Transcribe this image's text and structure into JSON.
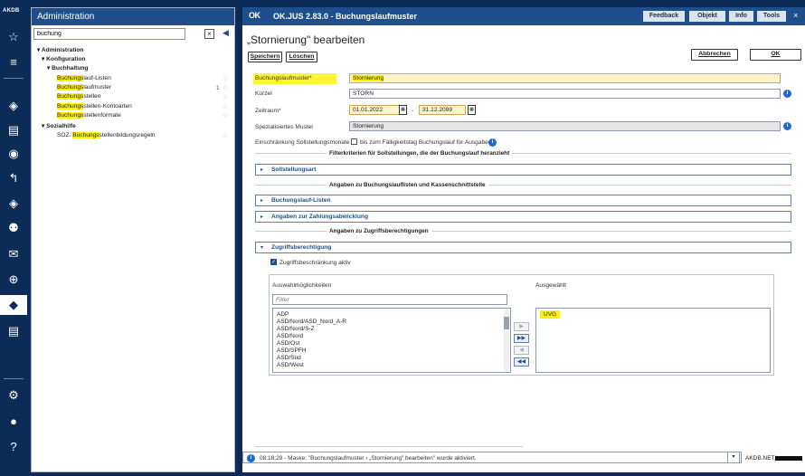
{
  "rail": {
    "logo": "AKDB",
    "icons": [
      "star-icon",
      "menu-icon",
      "user-gear-icon",
      "document-settings-icon",
      "people-search-icon",
      "flow-icon",
      "family-gear-icon",
      "family-icon",
      "mail-icon",
      "target-icon",
      "user-admin-icon",
      "document-gear-icon",
      "settings-gears-icon",
      "user-icon",
      "help-icon"
    ],
    "glyphs": {
      "star": "☆",
      "menu": "≡",
      "mail": "✉",
      "target": "⊕",
      "user": "●",
      "help": "?",
      "gears": "⚙",
      "doc": "▤",
      "generic": "◈"
    }
  },
  "admin": {
    "title": "Administration",
    "search_value": "buchung",
    "tree": [
      {
        "label": "Administration",
        "level": 0,
        "bold": true,
        "caret": "▾"
      },
      {
        "label": "Konfiguration",
        "level": 1,
        "bold": true,
        "caret": "▾"
      },
      {
        "label": "Buchhaltung",
        "level": 2,
        "bold": true,
        "caret": "▾"
      },
      {
        "hl": "Buchungs",
        "rest": "lauf-Listen",
        "level": 3,
        "star": true
      },
      {
        "hl": "Buchungs",
        "rest": "laufmuster",
        "level": 3,
        "star": true,
        "count": "1"
      },
      {
        "hl": "Buchungs",
        "rest": "stellen",
        "level": 3,
        "star": true
      },
      {
        "hl": "Buchungs",
        "rest": "stellen-Kontoarten",
        "level": 3,
        "star": true
      },
      {
        "hl": "Buchungs",
        "rest": "stellenformate",
        "level": 3,
        "star": true
      },
      {
        "label": "Sozialhilfe",
        "level": 1,
        "bold": true,
        "caret": "▾"
      },
      {
        "pre": "SOZ. ",
        "hl": "Buchungs",
        "rest": "stellenbildungsregeln",
        "level": 3,
        "star": true
      }
    ]
  },
  "window": {
    "app_logo": "OK",
    "title": "OK.JUS 2.83.0 - Buchungslaufmuster",
    "top_buttons": [
      "Feedback",
      "Objekt",
      "Info",
      "Tools"
    ],
    "close": "×"
  },
  "form": {
    "heading": "„Stornierung\" bearbeiten",
    "buttons": {
      "save": "Speichern",
      "delete": "Löschen",
      "cancel": "Abbrechen",
      "ok": "OK"
    },
    "fields": {
      "muster_label": "Buchungslaufmuster*",
      "muster_value": "Stornierung",
      "kuerzel_label": "Kürzel",
      "kuerzel_value": "STORN",
      "zeitraum_label": "Zeitraum*",
      "date_from": "01.01.2022",
      "date_sep": "-",
      "date_to": "31.12.2099",
      "spez_label": "Spezialisiertes Muster",
      "spez_value": "Stornierung",
      "einschr_label": "Einschränkung Sollstellungsmonate",
      "einschr_option": "bis zum Fälligkeitstag Buchungslauf für Ausgaben"
    },
    "sections": {
      "filter_title": "Filterkriterien für Sollstellungen, die der Buchungslauf heranzieht",
      "sollstellungsart": "Sollstellungsart",
      "angaben_listen_title": "Angaben zu Buchungslauflisten und Kassenschnittstelle",
      "buchungslauf_listen": "Buchungslauf-Listen",
      "zahlungsabwicklung": "Angaben zur Zahlungsabwicklung",
      "zugriff_title": "Angaben zu Zugriffsberechtigungen",
      "zugriffsberechtigung": "Zugriffsberechtigung"
    },
    "zugriff": {
      "checkbox_label": "Zugriffsbeschränkung aktiv",
      "available_title": "Auswahlmöglichkeiten",
      "selected_title": "Ausgewählt",
      "filter_placeholder": "Filter",
      "available": [
        "ADP",
        "ASD/Nord/ASD_Nord_A-R",
        "ASD/Nord/S-Z",
        "ASD/Nord",
        "ASD/Ost",
        "ASD/SPFH",
        "ASD/Süd",
        "ASD/West"
      ],
      "selected": [
        "UVG"
      ],
      "move_buttons": [
        "▶",
        "▶▶",
        "◀",
        "◀◀"
      ]
    }
  },
  "status": {
    "message": "08:18:29 - Maske: \"Buchungslaufmuster › „Stornierung\" bearbeiten\" wurde aktiviert.",
    "server": "AKDB.NET/"
  },
  "colors": {
    "brand": "#1f4e8c",
    "rail": "#0d2b57",
    "highlight": "#fff200",
    "info": "#1f66d6"
  }
}
